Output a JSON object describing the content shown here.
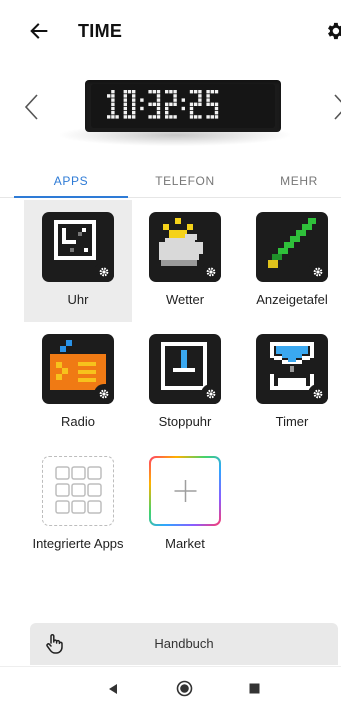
{
  "appbar": {
    "title": "TIME",
    "back_icon": "arrow-left-icon",
    "settings_icon": "gear-icon"
  },
  "device": {
    "clock_text": "10:32:25",
    "prev_icon": "chevron-left-icon",
    "next_icon": "chevron-right-icon"
  },
  "tabs": [
    {
      "label": "APPS",
      "active": true
    },
    {
      "label": "TELEFON",
      "active": false
    },
    {
      "label": "MEHR",
      "active": false
    }
  ],
  "apps": [
    {
      "label": "Uhr",
      "icon": "clock-app-icon",
      "selected": true
    },
    {
      "label": "Wetter",
      "icon": "weather-app-icon",
      "selected": false
    },
    {
      "label": "Anzeigetafel",
      "icon": "scoreboard-app-icon",
      "selected": false
    },
    {
      "label": "Radio",
      "icon": "radio-app-icon",
      "selected": false
    },
    {
      "label": "Stoppuhr",
      "icon": "stopwatch-app-icon",
      "selected": false
    },
    {
      "label": "Timer",
      "icon": "hourglass-app-icon",
      "selected": false
    },
    {
      "label": "Integrierte Apps",
      "icon": "grid-icon",
      "selected": false
    },
    {
      "label": "Market",
      "icon": "plus-icon",
      "selected": false
    }
  ],
  "handbuch": {
    "label": "Handbuch",
    "icon": "hand-pointer-icon"
  },
  "navbar": {
    "back_icon": "triangle-back-icon",
    "home_icon": "circle-home-icon",
    "recents_icon": "square-recents-icon"
  },
  "colors": {
    "accent": "#2e7bd6",
    "icon_bg": "#1c1c1c",
    "selected_bg": "#ececec"
  }
}
